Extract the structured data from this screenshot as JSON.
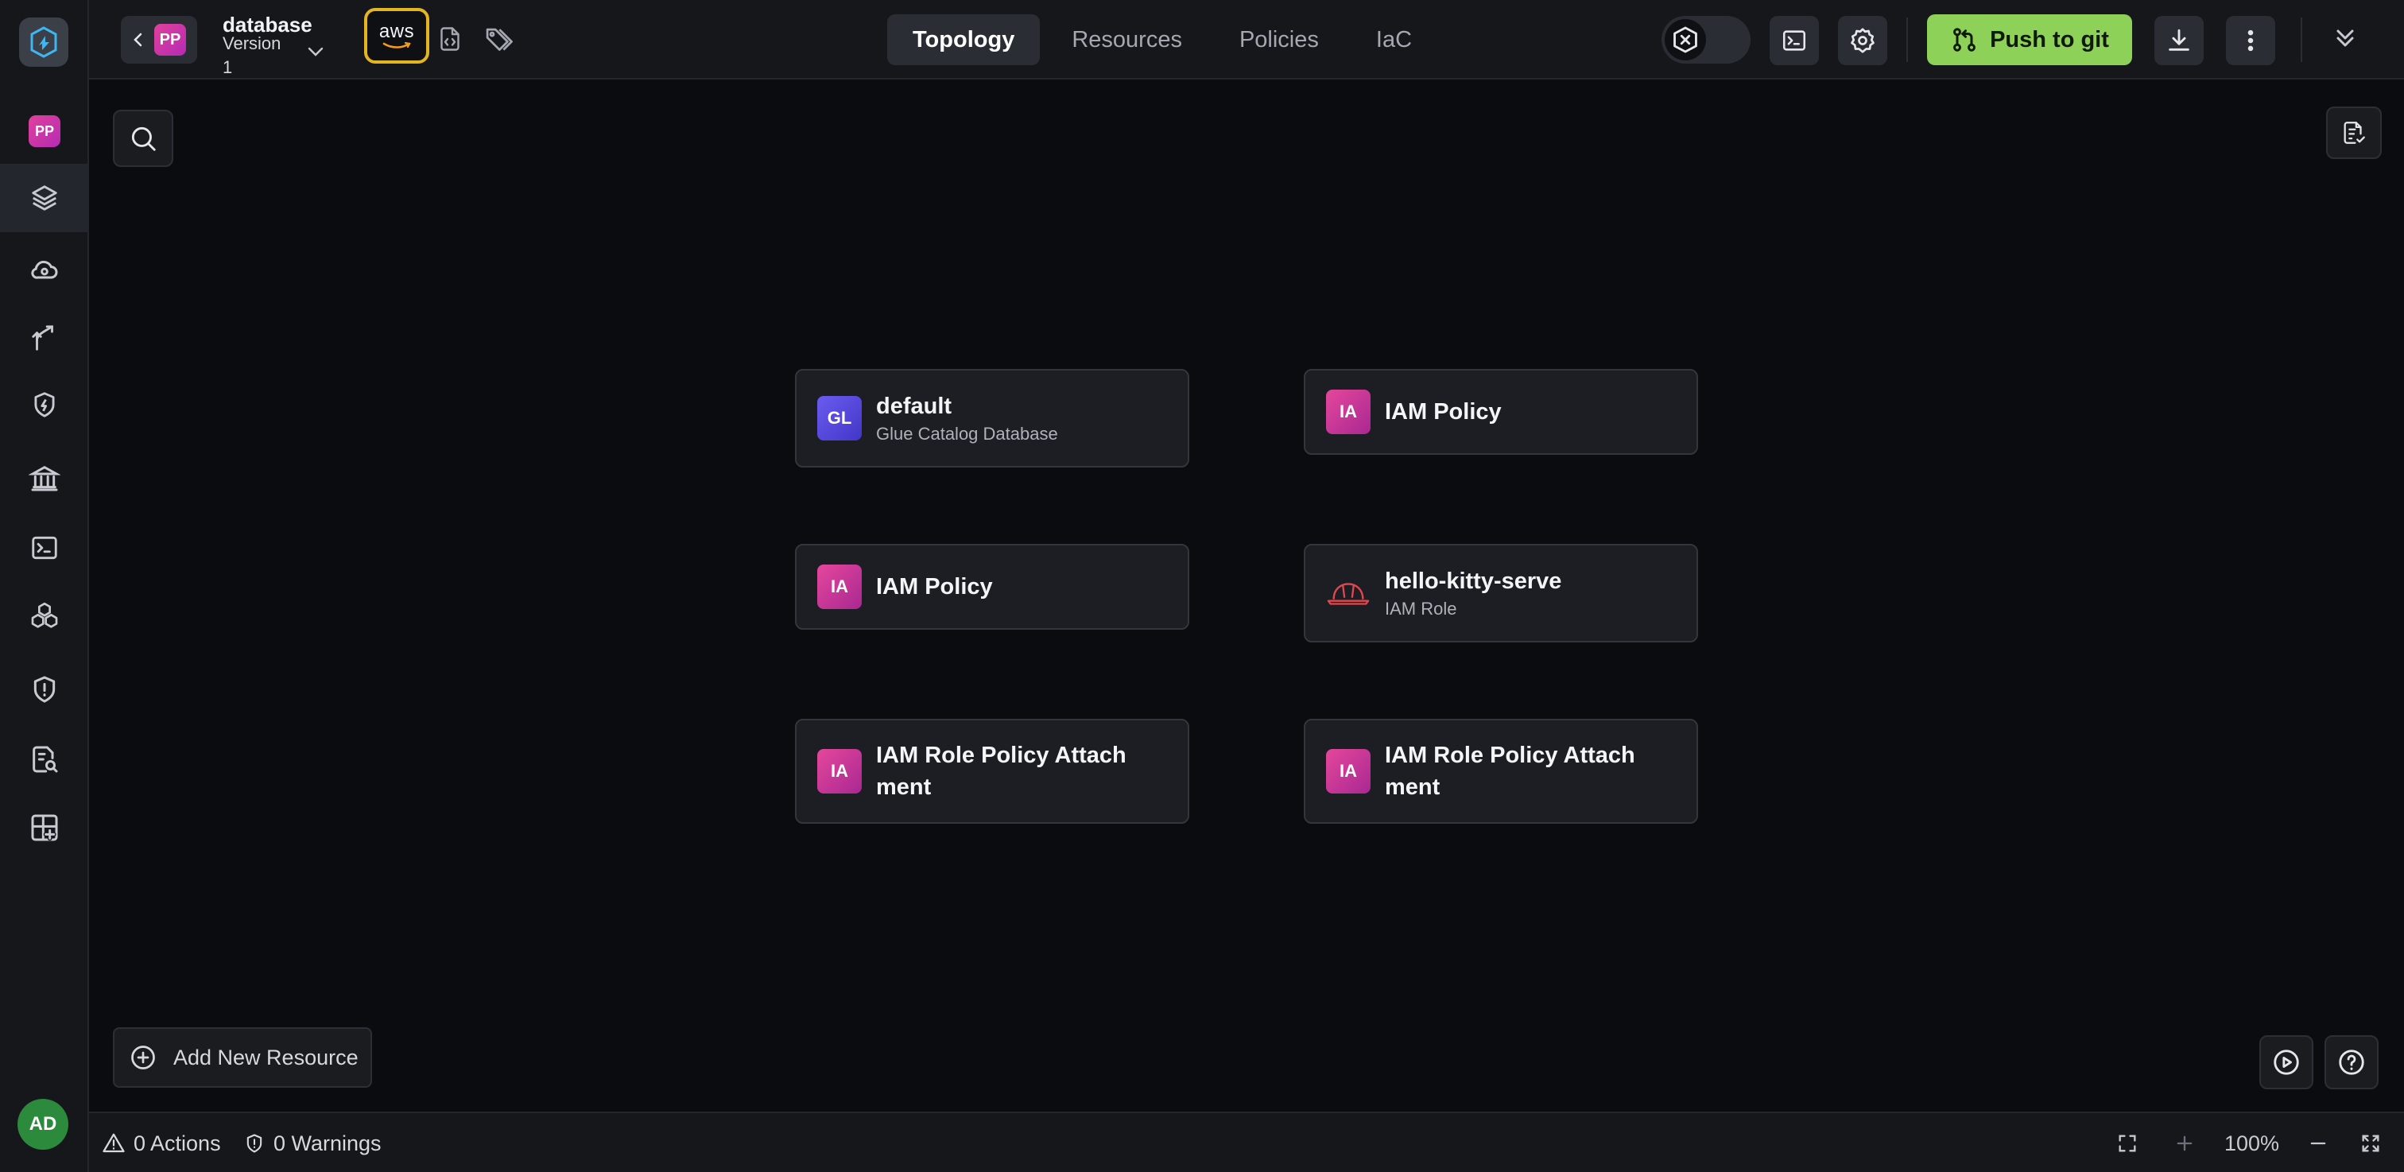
{
  "rail": {
    "project_initials": "PP",
    "user_initials": "AD"
  },
  "header": {
    "project_initials": "PP",
    "project_name": "database",
    "version_label": "Version",
    "version_value": "1",
    "provider_label": "aws",
    "tabs": [
      {
        "label": "Topology",
        "active": true
      },
      {
        "label": "Resources",
        "active": false
      },
      {
        "label": "Policies",
        "active": false
      },
      {
        "label": "IaC",
        "active": false
      }
    ],
    "push_label": "Push to git"
  },
  "nodes": [
    {
      "icon_text": "GL",
      "icon_color": "#5a4ce6",
      "title": "default",
      "subtitle": "Glue Catalog Database"
    },
    {
      "icon_text": "IA",
      "icon_color": "#d63a98",
      "title": "IAM Policy",
      "subtitle": ""
    },
    {
      "icon_text": "IA",
      "icon_color": "#d63a98",
      "title": "IAM Policy",
      "subtitle": ""
    },
    {
      "icon": "hardhat-icon",
      "title": "hello-kitty-serve",
      "subtitle": "IAM Role"
    },
    {
      "icon_text": "IA",
      "icon_color": "#d63a98",
      "title_line1": "IAM Role Policy Attach",
      "title_line2": "ment"
    },
    {
      "icon_text": "IA",
      "icon_color": "#d63a98",
      "title_line1": "IAM Role Policy Attach",
      "title_line2": "ment"
    }
  ],
  "canvas": {
    "add_resource_label": "Add New Resource"
  },
  "status": {
    "actions": "0 Actions",
    "warnings": "0 Warnings",
    "zoom": "100%"
  },
  "colors": {
    "accent_push": "#8ed158",
    "aws_highlight": "#e3b521",
    "background": "#0b0c0f"
  }
}
